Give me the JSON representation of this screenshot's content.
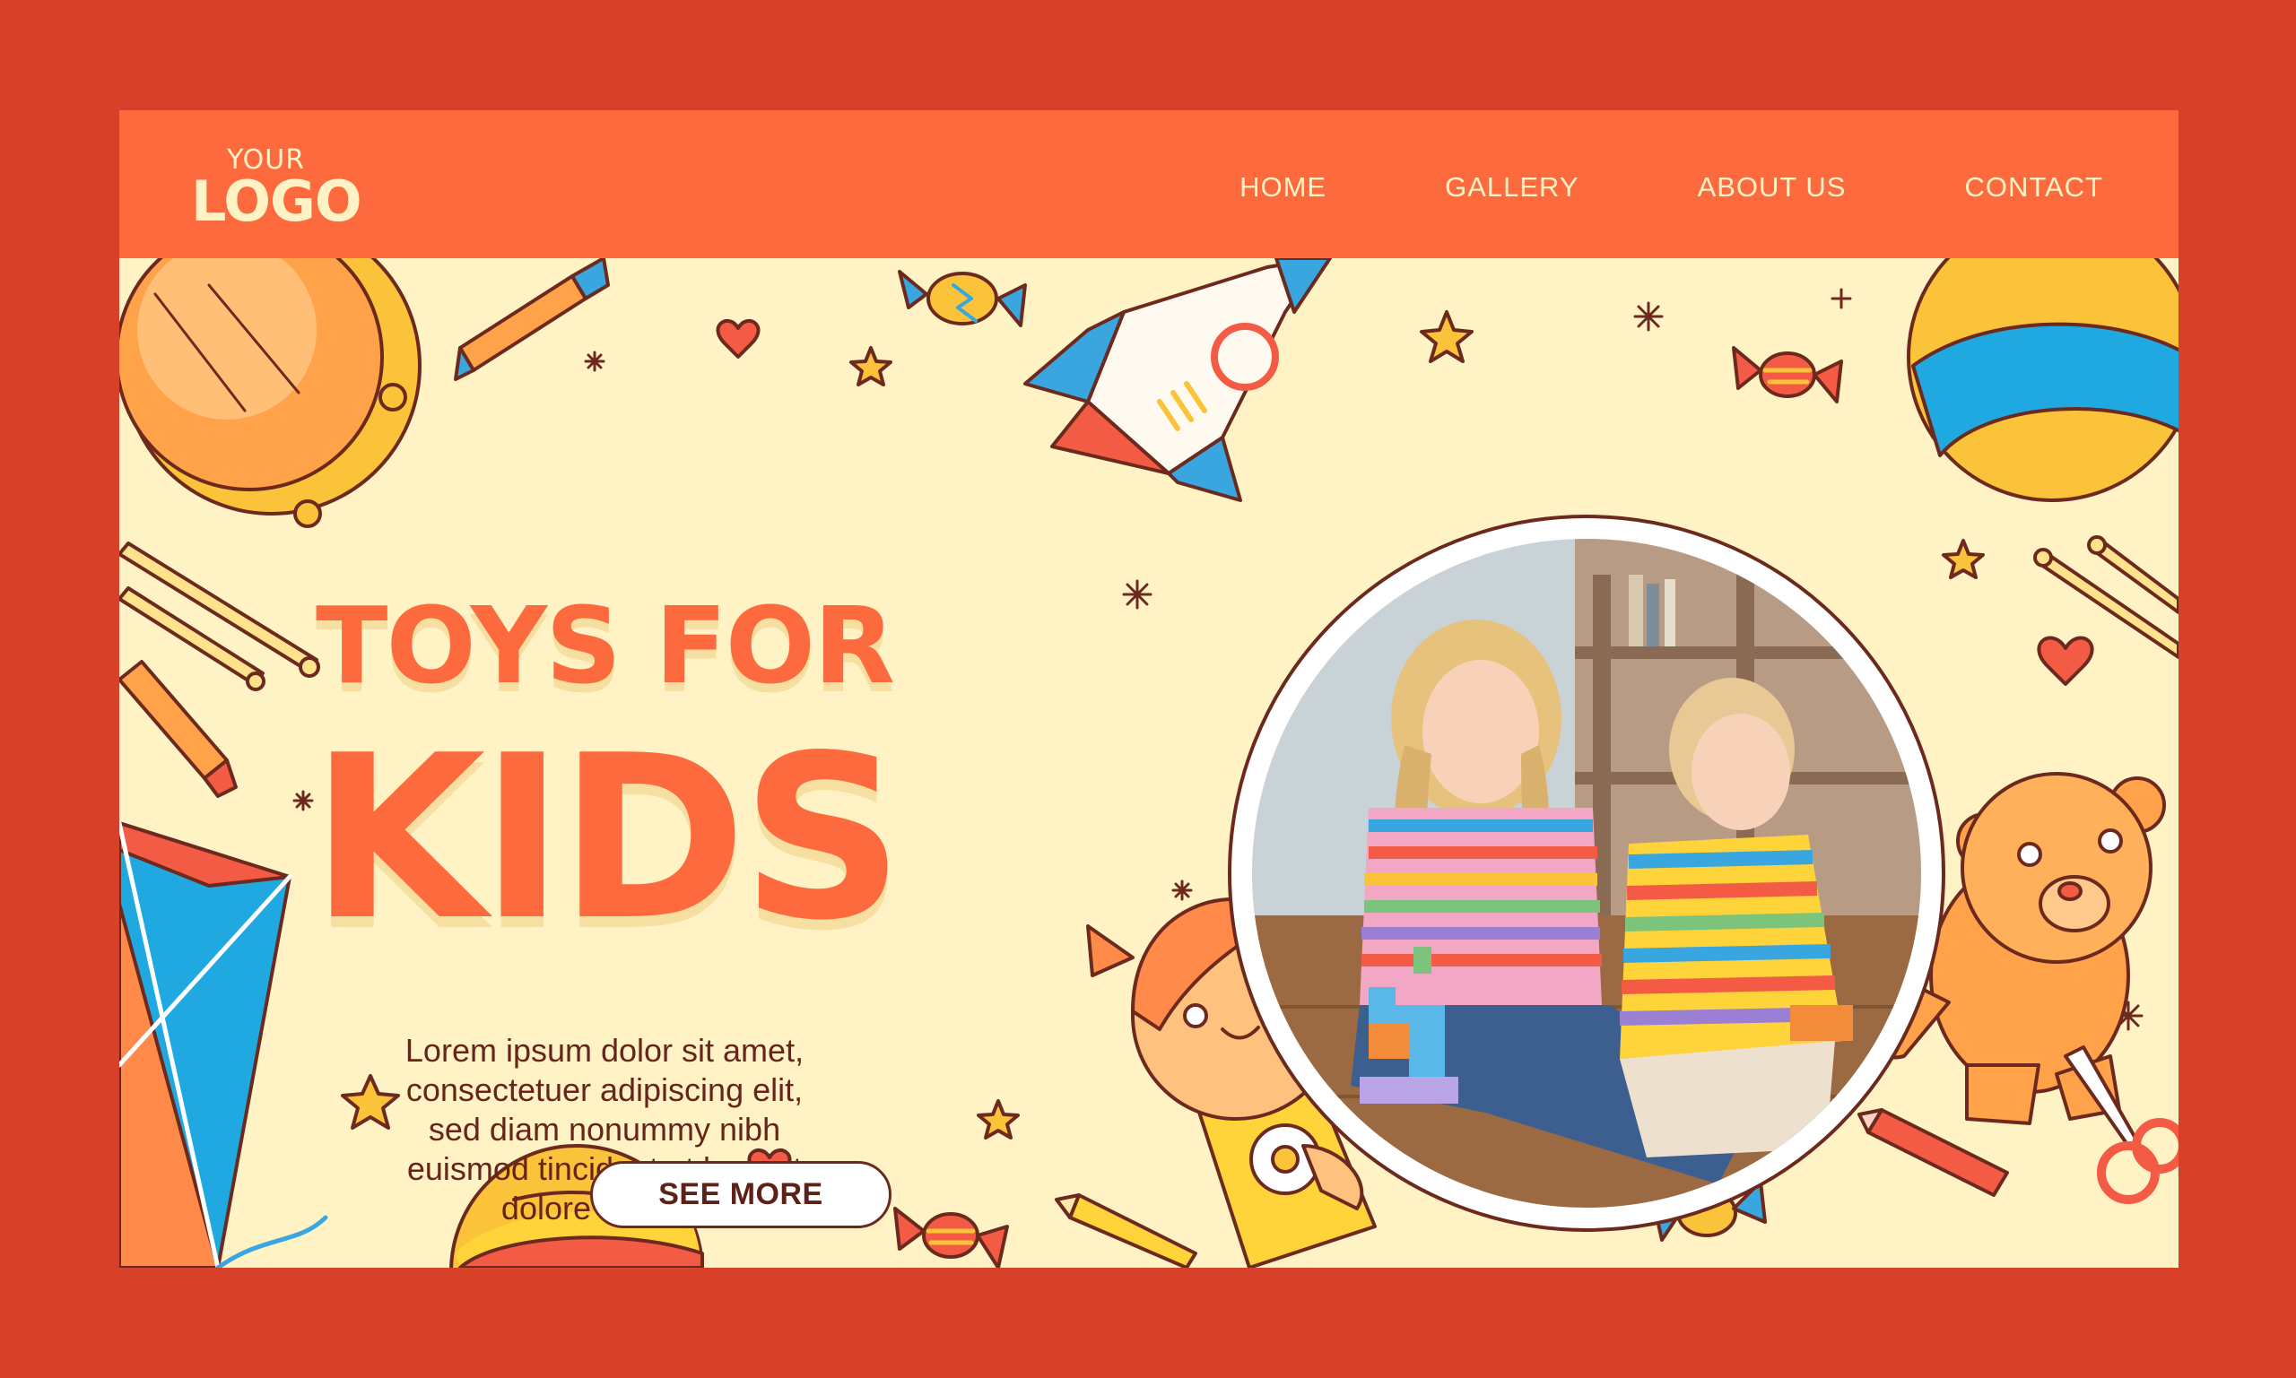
{
  "header": {
    "logo_small": "YOUR",
    "logo_big": "LOGO",
    "nav": [
      {
        "label": "HOME"
      },
      {
        "label": "GALLERY"
      },
      {
        "label": "ABOUT US"
      },
      {
        "label": "CONTACT"
      }
    ]
  },
  "hero": {
    "title_line1": "TOYS FOR",
    "title_line2": "KIDS",
    "description": "Lorem ipsum dolor sit amet, consectetuer adipiscing elit, sed diam nonummy nibh euismod tincidunt ut laoreet dolore magna.",
    "button_label": "SEE MORE"
  },
  "colors": {
    "page_border": "#d84129",
    "header_bg": "#fd6a3d",
    "hero_bg": "#fff3c6",
    "accent": "#fd6a3d",
    "text_dark": "#66241a"
  }
}
